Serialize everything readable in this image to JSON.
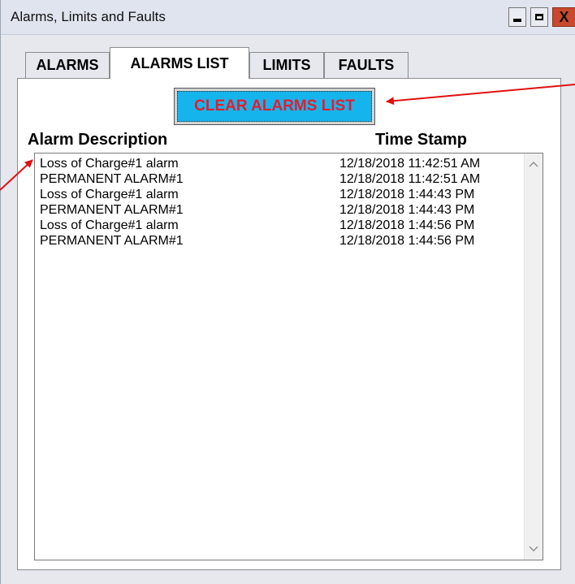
{
  "window": {
    "title": "Alarms, Limits and Faults",
    "close_glyph": "X"
  },
  "tabs": [
    {
      "label": "ALARMS",
      "active": false
    },
    {
      "label": "ALARMS LIST",
      "active": true
    },
    {
      "label": "LIMITS",
      "active": false
    },
    {
      "label": "FAULTS",
      "active": false
    }
  ],
  "clear_button": {
    "label": "CLEAR ALARMS LIST"
  },
  "columns": {
    "description": "Alarm Description",
    "timestamp": "Time Stamp"
  },
  "alarms": [
    {
      "description": "Loss of Charge#1 alarm",
      "timestamp": "12/18/2018 11:42:51 AM"
    },
    {
      "description": "PERMANENT ALARM#1",
      "timestamp": "12/18/2018 11:42:51 AM"
    },
    {
      "description": "Loss of Charge#1 alarm",
      "timestamp": "12/18/2018 1:44:43 PM"
    },
    {
      "description": "PERMANENT ALARM#1",
      "timestamp": "12/18/2018 1:44:43 PM"
    },
    {
      "description": "Loss of Charge#1 alarm",
      "timestamp": "12/18/2018 1:44:56 PM"
    },
    {
      "description": "PERMANENT ALARM#1",
      "timestamp": "12/18/2018 1:44:56 PM"
    }
  ],
  "icons": {
    "minimize": "minimize-icon",
    "maximize": "maximize-icon",
    "close": "close-icon",
    "scroll_up": "chevron-up-icon",
    "scroll_down": "chevron-down-icon"
  },
  "colors": {
    "clear_button_bg": "#16b4ec",
    "clear_button_text": "#e81c2b",
    "close_button": "#c8492d",
    "annotation_arrow": "#e01010"
  }
}
